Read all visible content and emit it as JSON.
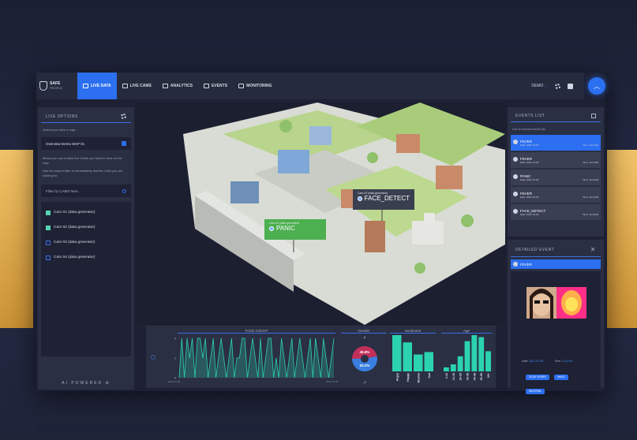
{
  "app": {
    "logo_line1": "SAFE",
    "logo_line2": "PEOPLE"
  },
  "nav": {
    "items": [
      {
        "label": "LIVE DATA"
      },
      {
        "label": "LIVE CAMS"
      },
      {
        "label": "ANALYTICS"
      },
      {
        "label": "EVENTS"
      },
      {
        "label": "MONITORING"
      }
    ],
    "user": "DEMO"
  },
  "left_panel": {
    "title": "LIVE OPTIONS",
    "select_map_hint": "Select your view a map.",
    "map_name": "Overview Demo MAP 01",
    "help1": "Below you can enable the CAMs you want to view on the map.",
    "help2": "Use the search filter to immediately find the CAM you are looking for.",
    "filter_placeholder": "Filter by CAMS here...",
    "cams": [
      {
        "label": "Cam 01 (data generator)",
        "checked": true
      },
      {
        "label": "Cam 02 (data generator)",
        "checked": true
      },
      {
        "label": "Cam 03 (data generator)",
        "checked": false
      },
      {
        "label": "Cam 04 (data generator)",
        "checked": false
      }
    ],
    "footer": "AI POWERED"
  },
  "map": {
    "labels": [
      {
        "cam": "Cam 01 (data generator)",
        "event": "PANIC",
        "color": "#4caf50"
      },
      {
        "cam": "Cam 02 (data generator)",
        "event": "FACE_DETECT",
        "color": "#3a3f50"
      }
    ]
  },
  "bottom": {
    "face_count_title": "FACE COUNT",
    "gender_title": "Gender",
    "sentiment_title": "Sentiment",
    "age_title": "Age",
    "x_start": "2021-07-06",
    "x_end": "2021-07-06"
  },
  "chart_data": [
    {
      "type": "line",
      "title": "FACE COUNT",
      "ylim": [
        0,
        2
      ],
      "yticks": [
        "0",
        "1",
        "2"
      ],
      "x_start": "2021-07-06",
      "x_end": "2021-07-06",
      "values": [
        0,
        2,
        0,
        2,
        1,
        2,
        0,
        2,
        2,
        1,
        2,
        0,
        1,
        2,
        0,
        1,
        2,
        1,
        0,
        1,
        2,
        0,
        1,
        1,
        2,
        2,
        0,
        1,
        2,
        1,
        0,
        2,
        0,
        1,
        2,
        2,
        0,
        1,
        0,
        2,
        1,
        0,
        1,
        2,
        0,
        1,
        2,
        1,
        0,
        1,
        2,
        0,
        2,
        1,
        0,
        2,
        1,
        0,
        1,
        2
      ]
    },
    {
      "type": "pie",
      "title": "Gender",
      "labels": [
        "female",
        "male"
      ],
      "values": [
        46.8,
        53.2
      ],
      "value_labels": [
        "46.8%",
        "53.2%"
      ]
    },
    {
      "type": "bar",
      "title": "Sentiment",
      "categories": [
        "Angry",
        "Happy",
        "Neutral",
        "Sad"
      ],
      "values": [
        60,
        48,
        28,
        32
      ]
    },
    {
      "type": "bar",
      "title": "Age",
      "categories": [
        "0-12",
        "13-19",
        "20-29",
        "30-39",
        "40-49",
        "50-59",
        "60+"
      ],
      "values": [
        8,
        14,
        30,
        60,
        72,
        68,
        40
      ]
    }
  ],
  "events": {
    "title": "EVENTS LIST",
    "subtitle": "List of recent events (8)",
    "items": [
      {
        "name": "FEVER",
        "date": "2021-07-06",
        "time": "12:14:00"
      },
      {
        "name": "FEVER",
        "date": "2021-07-06",
        "time": "12:14:00"
      },
      {
        "name": "PANIC",
        "date": "2021-07-06",
        "time": "12:14:00"
      },
      {
        "name": "FEVER",
        "date": "2021-07-06",
        "time": "12:14:00"
      },
      {
        "name": "FACE_DETECT",
        "date": "2021-07-06",
        "time": "12:14:00"
      }
    ],
    "date_prefix": "Date:",
    "time_prefix": "Time:"
  },
  "detail": {
    "title": "DETAILED EVENT",
    "event": "FEVER",
    "date": "2021-07-06",
    "time": "12:14:00",
    "chips": [
      "20-30 YEARS",
      "MALE",
      "NEUTRAL"
    ]
  },
  "colors": {
    "accent": "#2c6ff0",
    "teal": "#2bd3b0",
    "female": "#c2305a",
    "male": "#3a7fe0"
  }
}
